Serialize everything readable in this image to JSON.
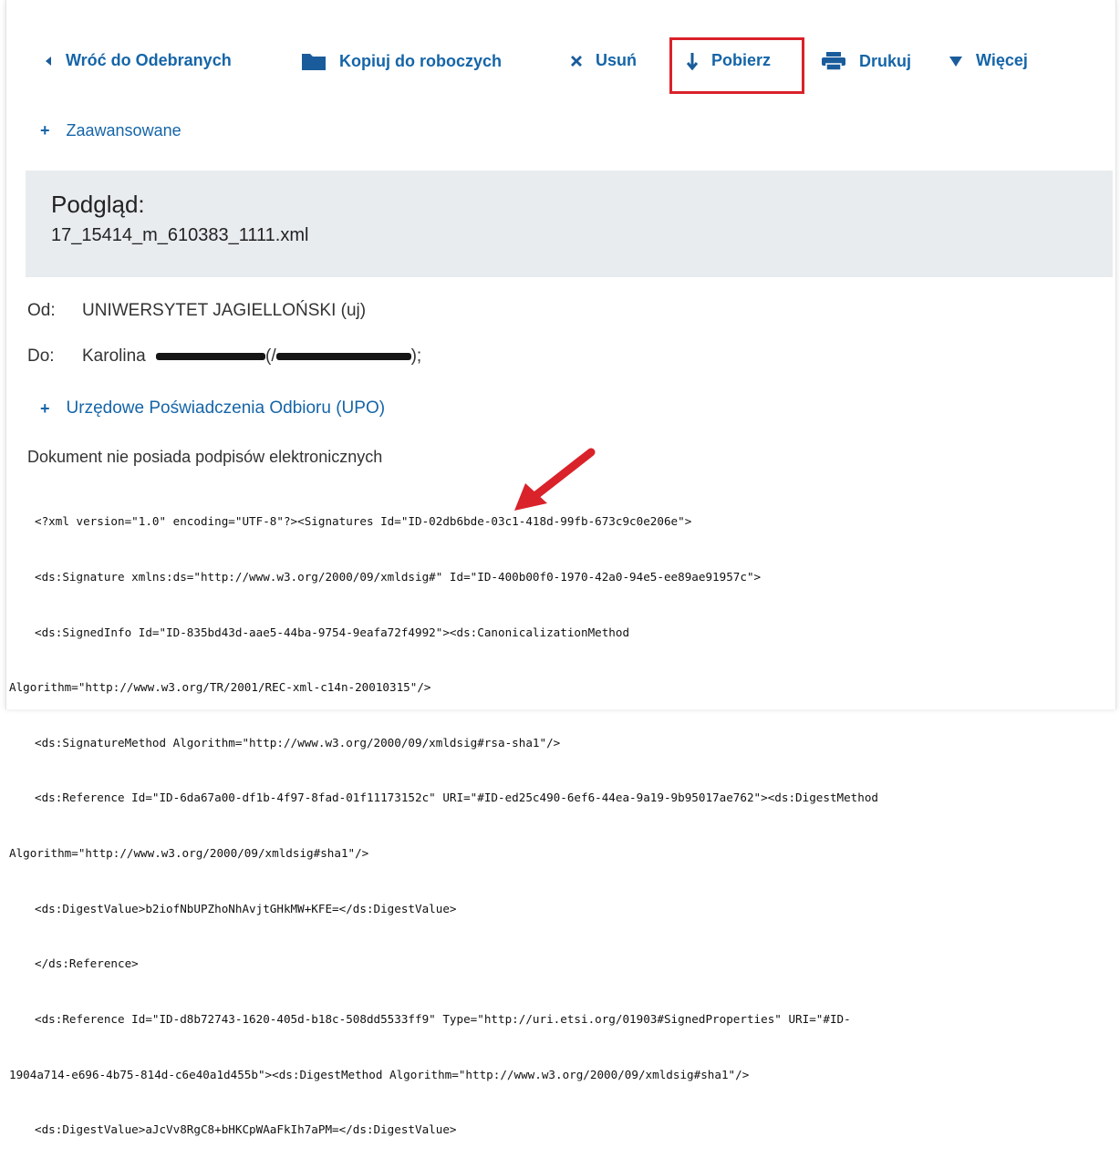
{
  "toolbar": {
    "back_label": "Wróć do Odebranych",
    "copy_label": "Kopiuj do roboczych",
    "delete_label": "Usuń",
    "download_label": "Pobierz",
    "print_label": "Drukuj",
    "more_label": "Więcej"
  },
  "advanced_label": "Zaawansowane",
  "preview": {
    "title": "Podgląd:",
    "filename": "17_15414_m_610383_1111.xml"
  },
  "from": {
    "label": "Od:",
    "value": "UNIWERSYTET JAGIELLOŃSKI (uj)"
  },
  "to": {
    "label": "Do:",
    "name": "Karolina",
    "open_paren": "(/",
    "close": ");"
  },
  "upo_label": "Urzędowe Poświadczenia Odbioru (UPO)",
  "no_signatures_text": "Dokument nie posiada podpisów elektronicznych",
  "xml_lines": [
    "<?xml version=\"1.0\" encoding=\"UTF-8\"?><Signatures Id=\"ID-02db6bde-03c1-418d-99fb-673c9c0e206e\">",
    "<ds:Signature xmlns:ds=\"http://www.w3.org/2000/09/xmldsig#\" Id=\"ID-400b00f0-1970-42a0-94e5-ee89ae91957c\">",
    "<ds:SignedInfo Id=\"ID-835bd43d-aae5-44ba-9754-9eafa72f4992\"><ds:CanonicalizationMethod",
    "Algorithm=\"http://www.w3.org/TR/2001/REC-xml-c14n-20010315\"/>",
    "<ds:SignatureMethod Algorithm=\"http://www.w3.org/2000/09/xmldsig#rsa-sha1\"/>",
    "<ds:Reference Id=\"ID-6da67a00-df1b-4f97-8fad-01f11173152c\" URI=\"#ID-ed25c490-6ef6-44ea-9a19-9b95017ae762\"><ds:DigestMethod",
    "Algorithm=\"http://www.w3.org/2000/09/xmldsig#sha1\"/>",
    "<ds:DigestValue>b2iofNbUPZhoNhAvjtGHkMW+KFE=</ds:DigestValue>",
    "</ds:Reference>",
    "<ds:Reference Id=\"ID-d8b72743-1620-405d-b18c-508dd5533ff9\" Type=\"http://uri.etsi.org/01903#SignedProperties\" URI=\"#ID-",
    "1904a714-e696-4b75-814d-c6e40a1d455b\"><ds:DigestMethod Algorithm=\"http://www.w3.org/2000/09/xmldsig#sha1\"/>",
    "<ds:DigestValue>aJcVv8RgC8+bHKCpWAaFkIh7aPM=</ds:DigestValue>"
  ],
  "colors": {
    "link": "#1565a8",
    "highlight": "#d9222a",
    "panel": "#e9ecef"
  }
}
